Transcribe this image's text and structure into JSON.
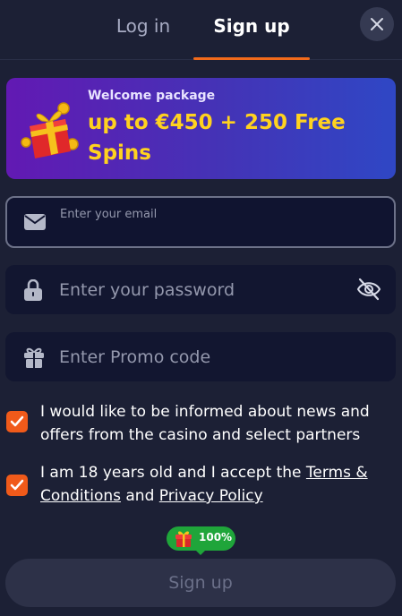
{
  "tabs": {
    "login_label": "Log in",
    "signup_label": "Sign up",
    "active": "signup"
  },
  "banner": {
    "subtitle": "Welcome package",
    "title": "up to €450 + 250 Free Spins"
  },
  "form": {
    "email_placeholder": "Enter your email",
    "password_placeholder": "Enter your password",
    "promo_placeholder": "Enter Promo code"
  },
  "consent": {
    "news_text": "I would like to be informed about news and offers from the casino and select partners",
    "news_checked": true,
    "terms_prefix": "I am 18 years old and I accept the ",
    "terms_link": "Terms & Conditions",
    "terms_and": " and ",
    "privacy_link": "Privacy Policy",
    "terms_checked": true
  },
  "progress_badge": {
    "value": "100%"
  },
  "submit": {
    "label": "Sign up"
  },
  "icons": {
    "close": "close-icon",
    "email": "envelope-icon",
    "password": "lock-icon",
    "visibility": "eye-off-icon",
    "promo": "gift-icon",
    "check": "checkmark-icon"
  },
  "colors": {
    "background": "#1c2035",
    "accent": "#f26a1b",
    "banner_title": "#ffd21f",
    "badge": "#1fa53a"
  }
}
